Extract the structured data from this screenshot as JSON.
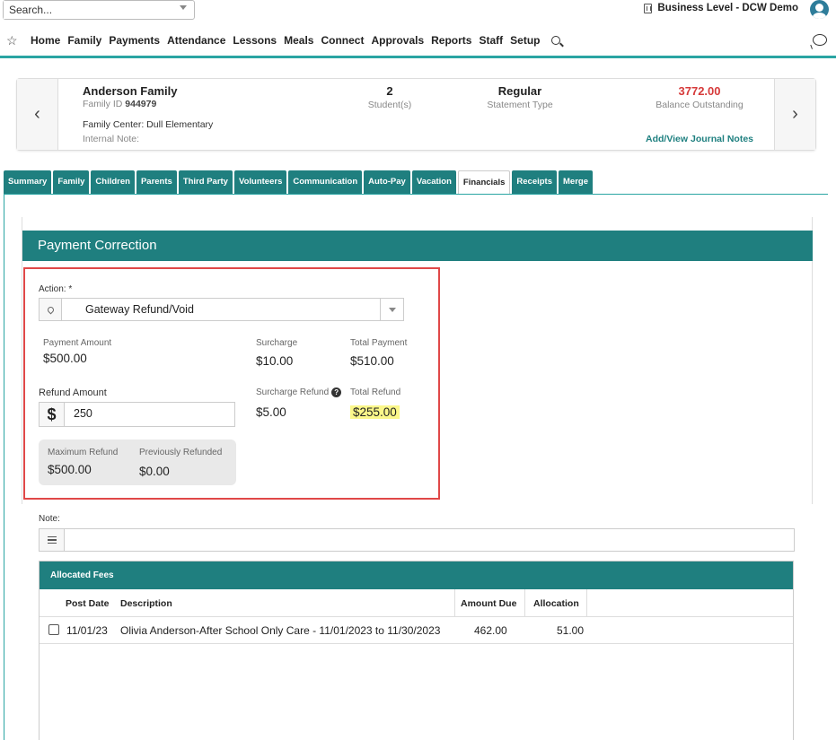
{
  "topbar": {
    "search_placeholder": "Search...",
    "business": "Business Level - DCW Demo"
  },
  "nav": {
    "items": [
      "Home",
      "Family",
      "Payments",
      "Attendance",
      "Lessons",
      "Meals",
      "Connect",
      "Approvals",
      "Reports",
      "Staff",
      "Setup"
    ]
  },
  "family": {
    "name": "Anderson Family",
    "id_label": "Family ID",
    "id_value": "944979",
    "center": "Family Center: Dull Elementary",
    "internal_note": "Internal Note:",
    "students_value": "2",
    "students_label": "Student(s)",
    "statement_value": "Regular",
    "statement_label": "Statement Type",
    "balance_value": "3772.00",
    "balance_label": "Balance Outstanding",
    "journal_link": "Add/View Journal Notes"
  },
  "tabs": [
    "Summary",
    "Family",
    "Children",
    "Parents",
    "Third Party",
    "Volunteers",
    "Communication",
    "Auto-Pay",
    "Vacation",
    "Financials",
    "Receipts",
    "Merge"
  ],
  "active_tab": "Financials",
  "payment_correction": {
    "title": "Payment Correction",
    "action_label": "Action: *",
    "action_value": "Gateway Refund/Void",
    "payment_amount_label": "Payment Amount",
    "payment_amount": "$500.00",
    "surcharge_label": "Surcharge",
    "surcharge": "$10.00",
    "total_payment_label": "Total Payment",
    "total_payment": "$510.00",
    "refund_amount_label": "Refund Amount",
    "currency_symbol": "$",
    "refund_amount": "250",
    "surcharge_refund_label": "Surcharge Refund",
    "surcharge_refund": "$5.00",
    "total_refund_label": "Total Refund",
    "total_refund": "$255.00",
    "max_refund_label": "Maximum Refund",
    "max_refund": "$500.00",
    "prev_refunded_label": "Previously Refunded",
    "prev_refunded": "$0.00"
  },
  "note": {
    "label": "Note:",
    "value": ""
  },
  "allocated_fees": {
    "title": "Allocated Fees",
    "columns": {
      "post_date": "Post Date",
      "description": "Description",
      "amount_due": "Amount Due",
      "allocation": "Allocation"
    },
    "rows": [
      {
        "post_date": "11/01/23",
        "description": "Olivia Anderson-After School Only Care - 11/01/2023 to 11/30/2023",
        "amount_due": "462.00",
        "allocation": "51.00"
      }
    ]
  },
  "colors": {
    "teal": "#1f7f7f",
    "accent_line": "#2aa5a3",
    "balance_red": "#d63a3a",
    "highlight": "#fbf78a",
    "annotation_red": "#e04848"
  }
}
